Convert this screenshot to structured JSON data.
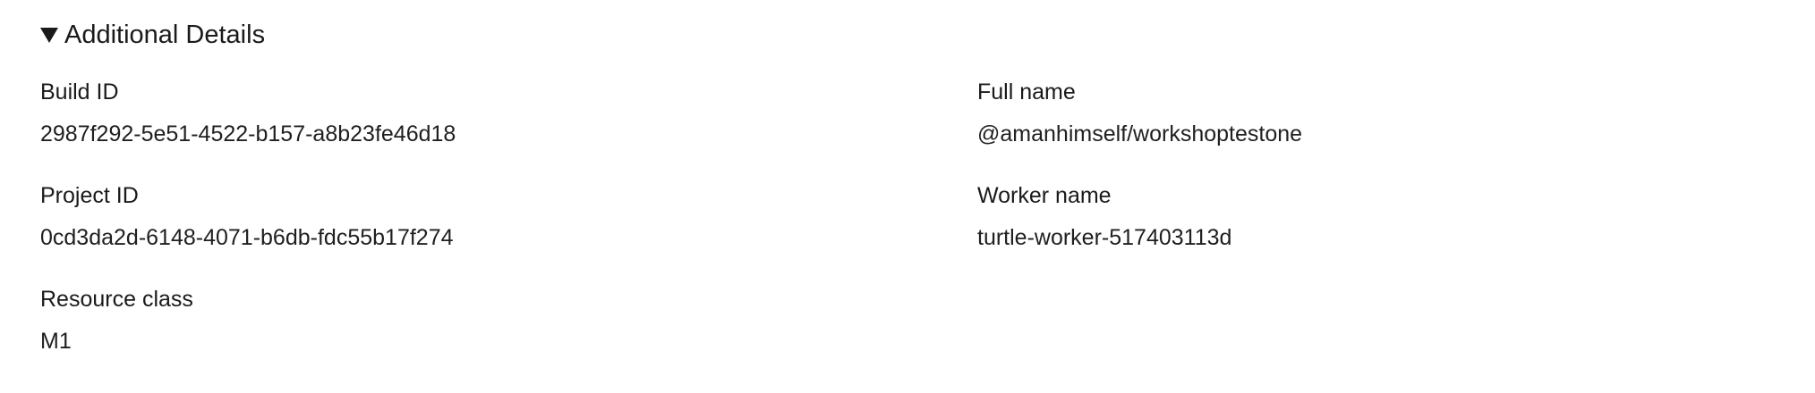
{
  "details": {
    "summary_label": "Additional Details",
    "fields": [
      {
        "label": "Build ID",
        "value": "2987f292-5e51-4522-b157-a8b23fe46d18"
      },
      {
        "label": "Full name",
        "value": "@amanhimself/workshoptestone"
      },
      {
        "label": "Project ID",
        "value": "0cd3da2d-6148-4071-b6db-fdc55b17f274"
      },
      {
        "label": "Worker name",
        "value": "turtle-worker-517403113d"
      },
      {
        "label": "Resource class",
        "value": "M1"
      }
    ]
  },
  "icons": {
    "toggle": "caret-down-icon"
  }
}
